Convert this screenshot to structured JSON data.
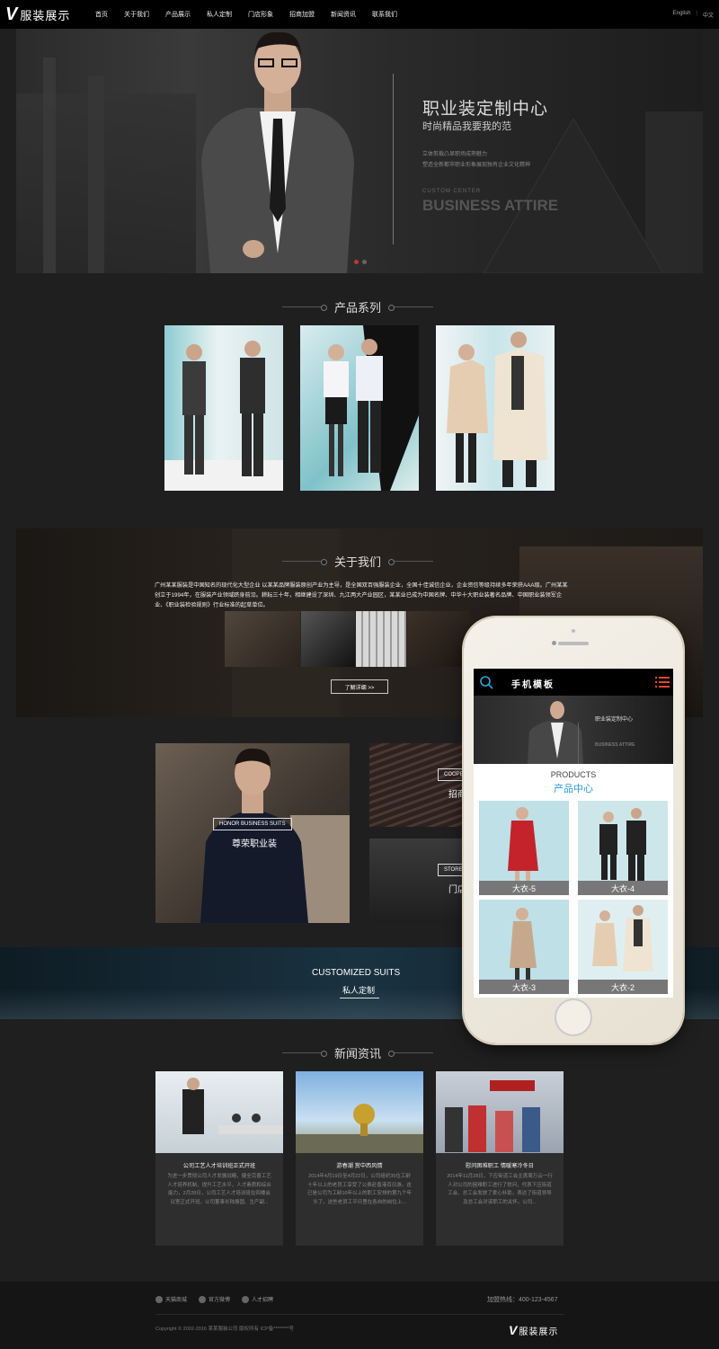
{
  "header": {
    "logo_text": "服装展示",
    "nav": [
      "首页",
      "关于我们",
      "产品展示",
      "私人定制",
      "门店形象",
      "招商加盟",
      "新闻资讯",
      "联系我们"
    ],
    "lang_en": "English",
    "lang_cn": "中文"
  },
  "banner": {
    "title": "职业装定制中心",
    "subtitle": "时尚精品我要我的范",
    "line1": "立体剪裁凸显职场成熟魅力",
    "line2": "塑造全新都市职业形象展现独有企业文化精神",
    "small_en": "CUSTOM CENTER",
    "big_en": "BUSINESS ATTIRE"
  },
  "products": {
    "heading": "产品系列"
  },
  "about": {
    "heading": "关于我们",
    "text": "广州某某服装是中国知名的现代化大型企业 以某某品牌服装原创产业为主导，是全国双百强服装企业，全国十佳诚信企业，企业资信等级持续多年荣获AAA级。广州某某创立于1994年，在服装产业领域跻身前沿。耕耘三十年，相继建设了深圳、九江两大产业园区，某某业已成为中国名牌、中华十大职业装著名品牌、中国职业装领军企业、《职业装检验规则》行业标准的起草单位。",
    "more_button": "了解详细 >>"
  },
  "features": {
    "big_label": "HONOR BUSINESS SUITS",
    "big_title": "尊荣职业装",
    "right_top_label": "COOPERATION",
    "right_top_title": "招商加盟",
    "right_bottom_label": "STORE",
    "right_bottom_title": "门店形象",
    "band_en": "CUSTOMIZED SUITS",
    "band_cn": "私人定制"
  },
  "news": {
    "heading": "新闻资讯",
    "items": [
      {
        "title": "公司工艺人才培训班正式开班",
        "desc": "为进一步贯彻公司人才发展战略，健全完善工艺人才培养机制，提升工艺水平，人才素质和综合能力，2月28日，公司工艺人才培训班在四楼会议室正式开班。公司董事长陆振国、生产副..."
      },
      {
        "title": "游春潮 赏中西风情",
        "desc": "2014年4月19日至4月22日，公司组织35位工龄十年以上的老员工享受了公费赴香港百日游。这已是公司为工龄10年以上的职工安排的第九个年头了。这些老员工平日里在各自的岗位上..."
      },
      {
        "title": "慰问困难职工 情暖寒冷冬日",
        "desc": "2014年11月28日，下应街道工会主席周万云一行人对公司的困难职工进行了慰问，代表下应街道工会、总工会发放了爱心补助，表达了街道领导及总工会对该职工的关怀。公司..."
      }
    ]
  },
  "footer": {
    "links": [
      "天猫商城",
      "官方微博",
      "人才招聘"
    ],
    "hotline": "加盟热线：400-123-4567",
    "copyright": "Copyright © 2002-2016 某某服装公司 版权所有   ICP备********号",
    "logo_text": "服装展示"
  },
  "phone": {
    "title": "手机模板",
    "banner_title": "职业装定制中心",
    "banner_en": "BUSINESS ATTIRE",
    "products_en": "PRODUCTS",
    "products_cn": "产品中心",
    "items": [
      "大衣-5",
      "大衣-4",
      "大衣-3",
      "大衣-2"
    ]
  }
}
